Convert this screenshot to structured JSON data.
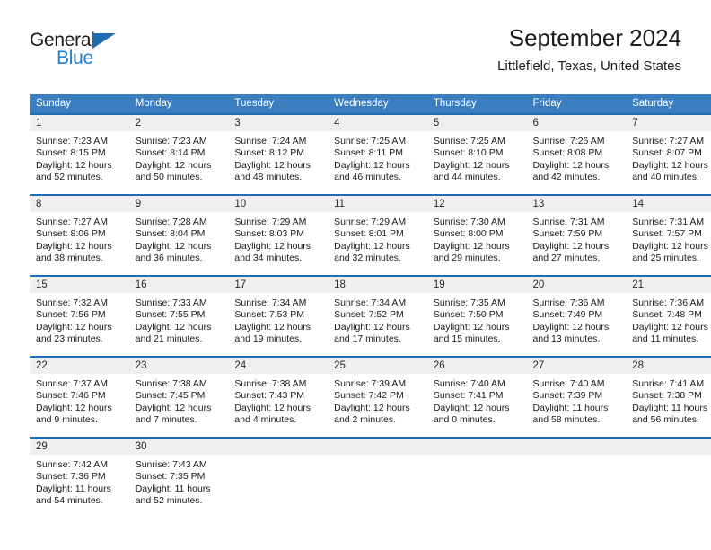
{
  "brand": {
    "name_top": "General",
    "name_bottom": "Blue",
    "triangle_color": "#1f6cb0",
    "blue_color": "#1f7fd0"
  },
  "header": {
    "title": "September 2024",
    "subtitle": "Littlefield, Texas, United States"
  },
  "theme": {
    "header_blue": "#3b7ebf",
    "divider_blue": "#1f6cb0",
    "daynum_gray": "#efefef"
  },
  "weekday_headers": [
    "Sunday",
    "Monday",
    "Tuesday",
    "Wednesday",
    "Thursday",
    "Friday",
    "Saturday"
  ],
  "weeks": [
    [
      {
        "day": "1",
        "sunrise": "Sunrise: 7:23 AM",
        "sunset": "Sunset: 8:15 PM",
        "daylight": "Daylight: 12 hours and 52 minutes."
      },
      {
        "day": "2",
        "sunrise": "Sunrise: 7:23 AM",
        "sunset": "Sunset: 8:14 PM",
        "daylight": "Daylight: 12 hours and 50 minutes."
      },
      {
        "day": "3",
        "sunrise": "Sunrise: 7:24 AM",
        "sunset": "Sunset: 8:12 PM",
        "daylight": "Daylight: 12 hours and 48 minutes."
      },
      {
        "day": "4",
        "sunrise": "Sunrise: 7:25 AM",
        "sunset": "Sunset: 8:11 PM",
        "daylight": "Daylight: 12 hours and 46 minutes."
      },
      {
        "day": "5",
        "sunrise": "Sunrise: 7:25 AM",
        "sunset": "Sunset: 8:10 PM",
        "daylight": "Daylight: 12 hours and 44 minutes."
      },
      {
        "day": "6",
        "sunrise": "Sunrise: 7:26 AM",
        "sunset": "Sunset: 8:08 PM",
        "daylight": "Daylight: 12 hours and 42 minutes."
      },
      {
        "day": "7",
        "sunrise": "Sunrise: 7:27 AM",
        "sunset": "Sunset: 8:07 PM",
        "daylight": "Daylight: 12 hours and 40 minutes."
      }
    ],
    [
      {
        "day": "8",
        "sunrise": "Sunrise: 7:27 AM",
        "sunset": "Sunset: 8:06 PM",
        "daylight": "Daylight: 12 hours and 38 minutes."
      },
      {
        "day": "9",
        "sunrise": "Sunrise: 7:28 AM",
        "sunset": "Sunset: 8:04 PM",
        "daylight": "Daylight: 12 hours and 36 minutes."
      },
      {
        "day": "10",
        "sunrise": "Sunrise: 7:29 AM",
        "sunset": "Sunset: 8:03 PM",
        "daylight": "Daylight: 12 hours and 34 minutes."
      },
      {
        "day": "11",
        "sunrise": "Sunrise: 7:29 AM",
        "sunset": "Sunset: 8:01 PM",
        "daylight": "Daylight: 12 hours and 32 minutes."
      },
      {
        "day": "12",
        "sunrise": "Sunrise: 7:30 AM",
        "sunset": "Sunset: 8:00 PM",
        "daylight": "Daylight: 12 hours and 29 minutes."
      },
      {
        "day": "13",
        "sunrise": "Sunrise: 7:31 AM",
        "sunset": "Sunset: 7:59 PM",
        "daylight": "Daylight: 12 hours and 27 minutes."
      },
      {
        "day": "14",
        "sunrise": "Sunrise: 7:31 AM",
        "sunset": "Sunset: 7:57 PM",
        "daylight": "Daylight: 12 hours and 25 minutes."
      }
    ],
    [
      {
        "day": "15",
        "sunrise": "Sunrise: 7:32 AM",
        "sunset": "Sunset: 7:56 PM",
        "daylight": "Daylight: 12 hours and 23 minutes."
      },
      {
        "day": "16",
        "sunrise": "Sunrise: 7:33 AM",
        "sunset": "Sunset: 7:55 PM",
        "daylight": "Daylight: 12 hours and 21 minutes."
      },
      {
        "day": "17",
        "sunrise": "Sunrise: 7:34 AM",
        "sunset": "Sunset: 7:53 PM",
        "daylight": "Daylight: 12 hours and 19 minutes."
      },
      {
        "day": "18",
        "sunrise": "Sunrise: 7:34 AM",
        "sunset": "Sunset: 7:52 PM",
        "daylight": "Daylight: 12 hours and 17 minutes."
      },
      {
        "day": "19",
        "sunrise": "Sunrise: 7:35 AM",
        "sunset": "Sunset: 7:50 PM",
        "daylight": "Daylight: 12 hours and 15 minutes."
      },
      {
        "day": "20",
        "sunrise": "Sunrise: 7:36 AM",
        "sunset": "Sunset: 7:49 PM",
        "daylight": "Daylight: 12 hours and 13 minutes."
      },
      {
        "day": "21",
        "sunrise": "Sunrise: 7:36 AM",
        "sunset": "Sunset: 7:48 PM",
        "daylight": "Daylight: 12 hours and 11 minutes."
      }
    ],
    [
      {
        "day": "22",
        "sunrise": "Sunrise: 7:37 AM",
        "sunset": "Sunset: 7:46 PM",
        "daylight": "Daylight: 12 hours and 9 minutes."
      },
      {
        "day": "23",
        "sunrise": "Sunrise: 7:38 AM",
        "sunset": "Sunset: 7:45 PM",
        "daylight": "Daylight: 12 hours and 7 minutes."
      },
      {
        "day": "24",
        "sunrise": "Sunrise: 7:38 AM",
        "sunset": "Sunset: 7:43 PM",
        "daylight": "Daylight: 12 hours and 4 minutes."
      },
      {
        "day": "25",
        "sunrise": "Sunrise: 7:39 AM",
        "sunset": "Sunset: 7:42 PM",
        "daylight": "Daylight: 12 hours and 2 minutes."
      },
      {
        "day": "26",
        "sunrise": "Sunrise: 7:40 AM",
        "sunset": "Sunset: 7:41 PM",
        "daylight": "Daylight: 12 hours and 0 minutes."
      },
      {
        "day": "27",
        "sunrise": "Sunrise: 7:40 AM",
        "sunset": "Sunset: 7:39 PM",
        "daylight": "Daylight: 11 hours and 58 minutes."
      },
      {
        "day": "28",
        "sunrise": "Sunrise: 7:41 AM",
        "sunset": "Sunset: 7:38 PM",
        "daylight": "Daylight: 11 hours and 56 minutes."
      }
    ],
    [
      {
        "day": "29",
        "sunrise": "Sunrise: 7:42 AM",
        "sunset": "Sunset: 7:36 PM",
        "daylight": "Daylight: 11 hours and 54 minutes."
      },
      {
        "day": "30",
        "sunrise": "Sunrise: 7:43 AM",
        "sunset": "Sunset: 7:35 PM",
        "daylight": "Daylight: 11 hours and 52 minutes."
      },
      {
        "day": "",
        "sunrise": "",
        "sunset": "",
        "daylight": ""
      },
      {
        "day": "",
        "sunrise": "",
        "sunset": "",
        "daylight": ""
      },
      {
        "day": "",
        "sunrise": "",
        "sunset": "",
        "daylight": ""
      },
      {
        "day": "",
        "sunrise": "",
        "sunset": "",
        "daylight": ""
      },
      {
        "day": "",
        "sunrise": "",
        "sunset": "",
        "daylight": ""
      }
    ]
  ]
}
